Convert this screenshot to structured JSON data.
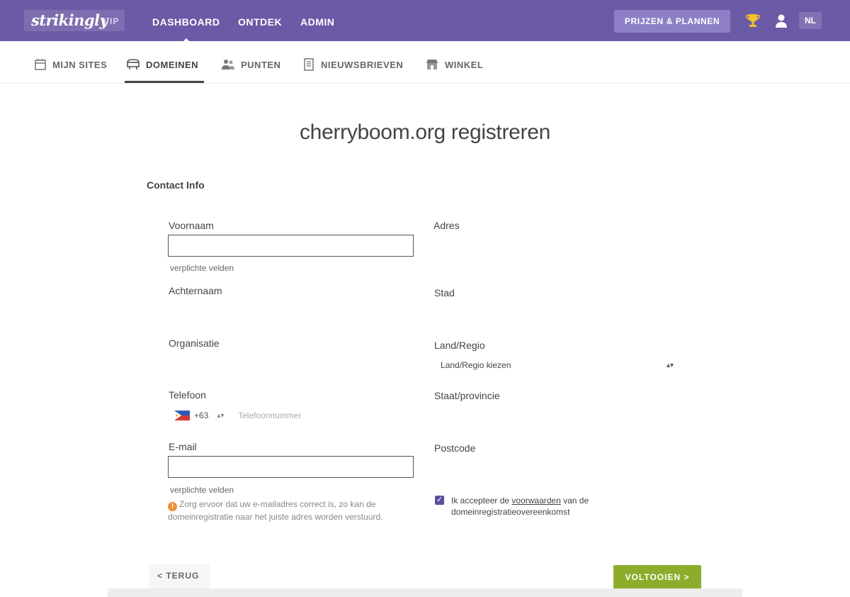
{
  "app": {
    "logo": "strikingly",
    "plan_badge": "VIP",
    "nav": [
      "DASHBOARD",
      "ONTDEK",
      "ADMIN"
    ],
    "plans_button": "PRIJZEN & PLANNEN",
    "language": "NL",
    "icons": [
      "trophy-icon",
      "user-icon"
    ]
  },
  "subnav": {
    "items": [
      {
        "label": "MIJN SITES",
        "icon": "calendar-icon"
      },
      {
        "label": "DOMEINEN",
        "icon": "domain-icon"
      },
      {
        "label": "PUNTEN",
        "icon": "people-icon"
      },
      {
        "label": "NIEUWSBRIEVEN",
        "icon": "newsletter-icon"
      },
      {
        "label": "WINKEL",
        "icon": "store-icon"
      }
    ],
    "active": "DOMEINEN"
  },
  "page": {
    "title": "cherryboom.org registreren",
    "section": "Contact Info"
  },
  "form": {
    "left": {
      "first_name": {
        "label": "Voornaam",
        "value": "",
        "required": "verplichte velden"
      },
      "last_name": {
        "label": "Achternaam"
      },
      "organization": {
        "label": "Organisatie"
      },
      "phone": {
        "label": "Telefoon",
        "country_code": "+63",
        "placeholder": "Telefoonnummer"
      },
      "email": {
        "label": "E-mail",
        "value": "",
        "required": "verplichte velden"
      },
      "info_text": "Zorg ervoor dat uw e-mailadres correct is, zo kan de domeinregistratie naar het juiste adres worden verstuurd."
    },
    "right": {
      "address": {
        "label": "Adres"
      },
      "city": {
        "label": "Stad"
      },
      "country": {
        "label": "Land/Regio",
        "selected": "Land/Regio kiezen"
      },
      "state": {
        "label": "Staat/provincie"
      },
      "postcode": {
        "label": "Postcode"
      },
      "agree_text": "Ik accepteer de",
      "agree_link": "voorwaarden",
      "agree_rest": "van de domeinregistratieovereenkomst"
    }
  },
  "actions": {
    "back": "< TERUG",
    "next": "VOLTOOIEN >"
  },
  "colors": {
    "topbar": "#6b5aa6",
    "accent_button": "#8dac2b",
    "plans_button": "#8d80c6"
  }
}
